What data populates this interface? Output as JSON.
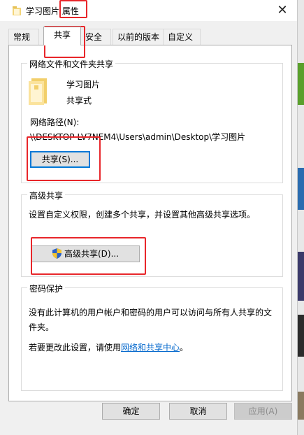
{
  "window": {
    "title_part1": "学习图片",
    "title_part2": "属性",
    "close_glyph": "✕"
  },
  "tabs": [
    {
      "label": "常规"
    },
    {
      "label": "共享"
    },
    {
      "label": "安全"
    },
    {
      "label": "以前的版本"
    },
    {
      "label": "自定义"
    }
  ],
  "network_sharing": {
    "group_title": "网络文件和文件夹共享",
    "folder_name": "学习图片",
    "folder_state": "共享式",
    "path_label": "网络路径(N):",
    "path_value": "\\\\DESKTOP-LV7NEM4\\Users\\admin\\Desktop\\学习图片",
    "share_button": "共享(S)..."
  },
  "advanced_sharing": {
    "group_title": "高级共享",
    "description": "设置自定义权限，创建多个共享，并设置其他高级共享选项。",
    "button": "高级共享(D)..."
  },
  "password_protection": {
    "group_title": "密码保护",
    "description": "没有此计算机的用户帐户和密码的用户可以访问与所有人共享的文件夹。",
    "change_prefix": "若要更改此设置，请使用",
    "change_link": "网络和共享中心",
    "change_suffix": "。"
  },
  "footer": {
    "ok": "确定",
    "cancel": "取消",
    "apply": "应用(A)"
  },
  "colors": {
    "accent": "#0078d7",
    "link": "#0066cc",
    "highlight": "#e8262a"
  }
}
